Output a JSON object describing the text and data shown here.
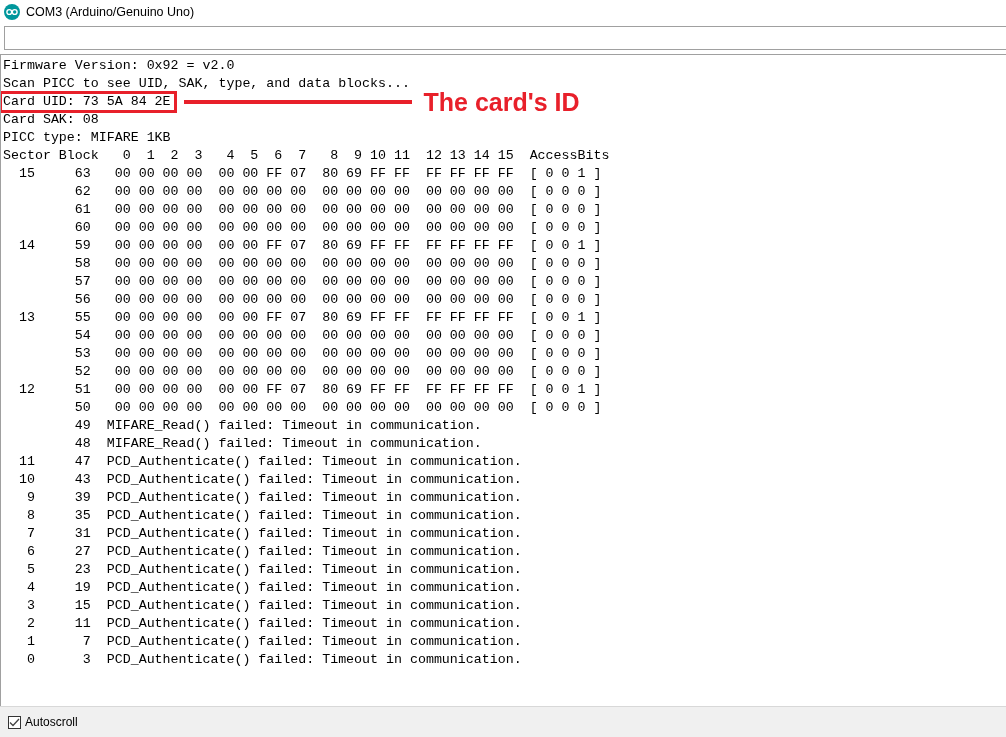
{
  "window": {
    "title": "COM3 (Arduino/Genuino Uno)"
  },
  "output": {
    "lines_before": [
      "Firmware Version: 0x92 = v2.0",
      "Scan PICC to see UID, SAK, type, and data blocks..."
    ],
    "highlighted_line": "Card UID: 73 5A 84 2E",
    "lines_after": [
      "Card SAK: 08",
      "PICC type: MIFARE 1KB",
      "Sector Block   0  1  2  3   4  5  6  7   8  9 10 11  12 13 14 15  AccessBits",
      "  15     63   00 00 00 00  00 00 FF 07  80 69 FF FF  FF FF FF FF  [ 0 0 1 ]",
      "         62   00 00 00 00  00 00 00 00  00 00 00 00  00 00 00 00  [ 0 0 0 ]",
      "         61   00 00 00 00  00 00 00 00  00 00 00 00  00 00 00 00  [ 0 0 0 ]",
      "         60   00 00 00 00  00 00 00 00  00 00 00 00  00 00 00 00  [ 0 0 0 ]",
      "  14     59   00 00 00 00  00 00 FF 07  80 69 FF FF  FF FF FF FF  [ 0 0 1 ]",
      "         58   00 00 00 00  00 00 00 00  00 00 00 00  00 00 00 00  [ 0 0 0 ]",
      "         57   00 00 00 00  00 00 00 00  00 00 00 00  00 00 00 00  [ 0 0 0 ]",
      "         56   00 00 00 00  00 00 00 00  00 00 00 00  00 00 00 00  [ 0 0 0 ]",
      "  13     55   00 00 00 00  00 00 FF 07  80 69 FF FF  FF FF FF FF  [ 0 0 1 ]",
      "         54   00 00 00 00  00 00 00 00  00 00 00 00  00 00 00 00  [ 0 0 0 ]",
      "         53   00 00 00 00  00 00 00 00  00 00 00 00  00 00 00 00  [ 0 0 0 ]",
      "         52   00 00 00 00  00 00 00 00  00 00 00 00  00 00 00 00  [ 0 0 0 ]",
      "  12     51   00 00 00 00  00 00 FF 07  80 69 FF FF  FF FF FF FF  [ 0 0 1 ]",
      "         50   00 00 00 00  00 00 00 00  00 00 00 00  00 00 00 00  [ 0 0 0 ]",
      "         49  MIFARE_Read() failed: Timeout in communication.",
      "         48  MIFARE_Read() failed: Timeout in communication.",
      "  11     47  PCD_Authenticate() failed: Timeout in communication.",
      "  10     43  PCD_Authenticate() failed: Timeout in communication.",
      "   9     39  PCD_Authenticate() failed: Timeout in communication.",
      "   8     35  PCD_Authenticate() failed: Timeout in communication.",
      "   7     31  PCD_Authenticate() failed: Timeout in communication.",
      "   6     27  PCD_Authenticate() failed: Timeout in communication.",
      "   5     23  PCD_Authenticate() failed: Timeout in communication.",
      "   4     19  PCD_Authenticate() failed: Timeout in communication.",
      "   3     15  PCD_Authenticate() failed: Timeout in communication.",
      "   2     11  PCD_Authenticate() failed: Timeout in communication.",
      "   1      7  PCD_Authenticate() failed: Timeout in communication.",
      "   0      3  PCD_Authenticate() failed: Timeout in communication."
    ]
  },
  "annotation": {
    "label": "The card's ID"
  },
  "autoscroll": {
    "label": "Autoscroll",
    "checked": true
  }
}
